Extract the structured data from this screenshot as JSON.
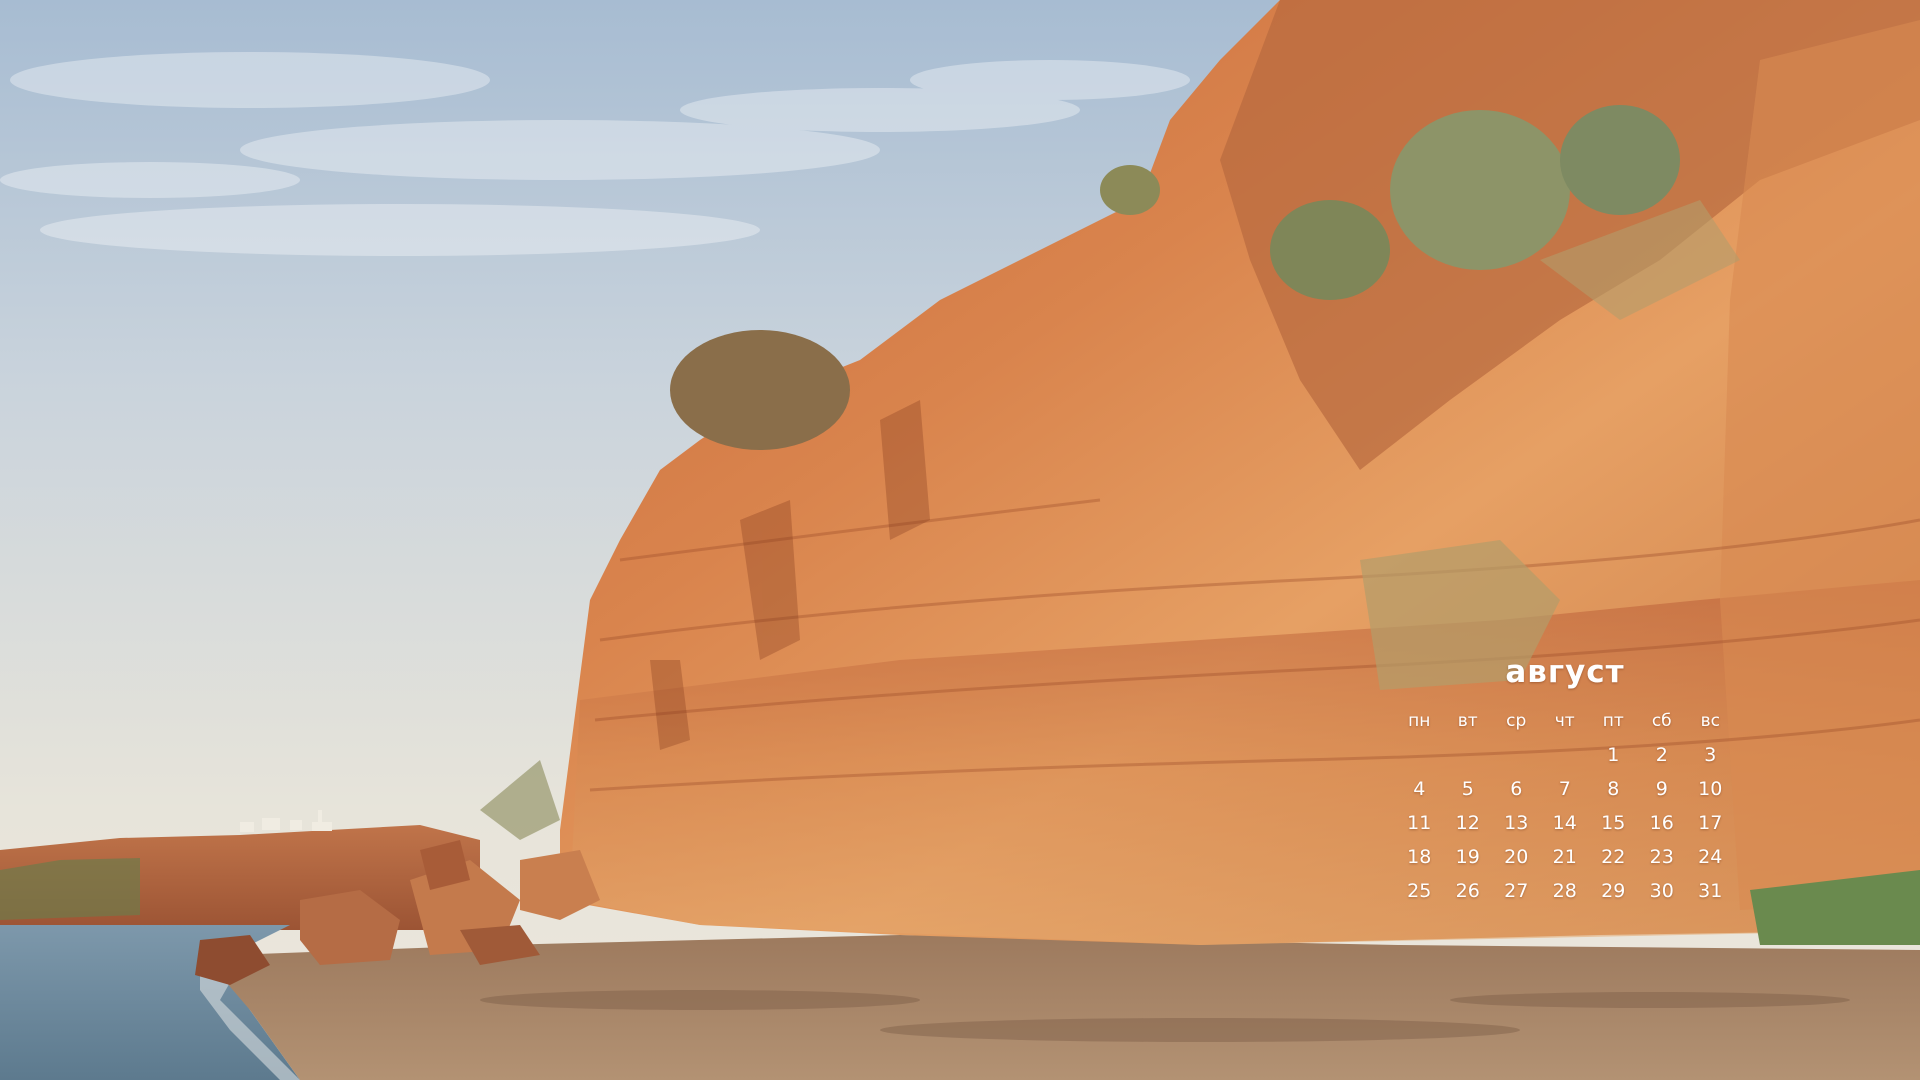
{
  "calendar": {
    "month": "август",
    "weekdays": [
      "пн",
      "вт",
      "ср",
      "чт",
      "пт",
      "сб",
      "вс"
    ],
    "leading_blanks": 4,
    "days": [
      "1",
      "2",
      "3",
      "4",
      "5",
      "6",
      "7",
      "8",
      "9",
      "10",
      "11",
      "12",
      "13",
      "14",
      "15",
      "16",
      "17",
      "18",
      "19",
      "20",
      "21",
      "22",
      "23",
      "24",
      "25",
      "26",
      "27",
      "28",
      "29",
      "30",
      "31"
    ]
  },
  "colors": {
    "sky_top": "#9fb6cf",
    "sky_bottom": "#e6e3d8",
    "cliff_light": "#e8a062",
    "cliff_mid": "#c9683a",
    "cliff_dark": "#8f3f22",
    "sea": "#6f8ea3",
    "beach": "#a88668",
    "vegetation": "#7d7a4a",
    "text": "#ffffff"
  }
}
